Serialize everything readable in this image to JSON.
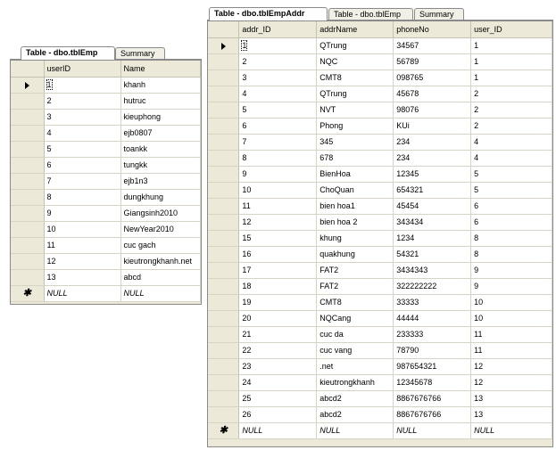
{
  "left": {
    "tabs": [
      {
        "label": "Table - dbo.tblEmp",
        "active": true
      },
      {
        "label": "Summary",
        "active": false
      }
    ],
    "columns": [
      "userID",
      "Name"
    ],
    "rows": [
      [
        "1",
        "khanh"
      ],
      [
        "2",
        "hutruc"
      ],
      [
        "3",
        "kieuphong"
      ],
      [
        "4",
        "ejb0807"
      ],
      [
        "5",
        "toankk"
      ],
      [
        "6",
        "tungkk"
      ],
      [
        "7",
        "ejb1n3"
      ],
      [
        "8",
        "dungkhung"
      ],
      [
        "9",
        "Giangsinh2010"
      ],
      [
        "10",
        "NewYear2010"
      ],
      [
        "11",
        "cuc gach"
      ],
      [
        "12",
        "kieutrongkhanh.net"
      ],
      [
        "13",
        "abcd"
      ]
    ],
    "new_row": [
      "NULL",
      "NULL"
    ]
  },
  "right": {
    "tabs": [
      {
        "label": "Table - dbo.tblEmpAddr",
        "active": true
      },
      {
        "label": "Table - dbo.tblEmp",
        "active": false
      },
      {
        "label": "Summary",
        "active": false
      }
    ],
    "columns": [
      "addr_ID",
      "addrName",
      "phoneNo",
      "user_ID"
    ],
    "rows": [
      [
        "1",
        "QTrung",
        "34567",
        "1"
      ],
      [
        "2",
        "NQC",
        "56789",
        "1"
      ],
      [
        "3",
        "CMT8",
        "098765",
        "1"
      ],
      [
        "4",
        "QTrung",
        "45678",
        "2"
      ],
      [
        "5",
        "NVT",
        "98076",
        "2"
      ],
      [
        "6",
        "Phong",
        "KUi",
        "2"
      ],
      [
        "7",
        "345",
        "234",
        "4"
      ],
      [
        "8",
        "678",
        "234",
        "4"
      ],
      [
        "9",
        "BienHoa",
        "12345",
        "5"
      ],
      [
        "10",
        "ChoQuan",
        "654321",
        "5"
      ],
      [
        "11",
        "bien hoa1",
        "45454",
        "6"
      ],
      [
        "12",
        "bien hoa 2",
        "343434",
        "6"
      ],
      [
        "15",
        "khung",
        "1234",
        "8"
      ],
      [
        "16",
        "quakhung",
        "54321",
        "8"
      ],
      [
        "17",
        "FAT2",
        "3434343",
        "9"
      ],
      [
        "18",
        "FAT2",
        "322222222",
        "9"
      ],
      [
        "19",
        "CMT8",
        "33333",
        "10"
      ],
      [
        "20",
        "NQCang",
        "44444",
        "10"
      ],
      [
        "21",
        "cuc da",
        "233333",
        "11"
      ],
      [
        "22",
        "cuc vang",
        "78790",
        "11"
      ],
      [
        "23",
        ".net",
        "987654321",
        "12"
      ],
      [
        "24",
        "kieutrongkhanh",
        "12345678",
        "12"
      ],
      [
        "25",
        "abcd2",
        "8867676766",
        "13"
      ],
      [
        "26",
        "abcd2",
        "8867676766",
        "13"
      ]
    ],
    "new_row": [
      "NULL",
      "NULL",
      "NULL",
      "NULL"
    ]
  },
  "icons": {
    "current_row": "row-pointer-icon",
    "new_row": "new-row-asterisk-icon"
  }
}
